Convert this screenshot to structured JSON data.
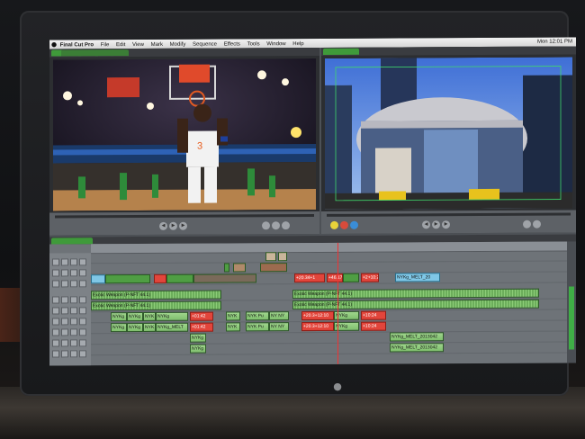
{
  "menubar": {
    "app_name": "Final Cut Pro",
    "menus": [
      "File",
      "Edit",
      "View",
      "Mark",
      "Modify",
      "Sequence",
      "Effects",
      "Tools",
      "Window",
      "Help"
    ],
    "clock": "Mon 12:01 PM"
  },
  "timeline": {
    "clips": {
      "v_nyk_melt": "NYKg_MELT_20",
      "red1": "+20.34+1",
      "red2": "+46.17",
      "red3": "+2+10:25",
      "a1_title": "Exotic Weapon (P-NFT 44.1)",
      "a1_title2": "Exotic Weapon (P-NFT 44.1)",
      "a2_title": "Exotic Weapon (P-NFT 44.1)",
      "a2_title2": "Exotic Weapon (P-NFT 44.1)",
      "a3_1": "NYKg",
      "a3_2": "NYKg",
      "a3_3": "NYK",
      "a3_4": "NYKg",
      "a3_red1": "+01:42",
      "a3_5": "NYK",
      "a3_6": "NYK Pu",
      "a3_7": "NY NY",
      "a3_red2": "+20.3+12:10",
      "a3_8": "NYKg",
      "a3_red3": "+10:24",
      "a4_1": "NYKg",
      "a4_2": "NYKg",
      "a4_3": "NYK",
      "a4_4": "NYKg_MELT",
      "a4_red1": "+01:42",
      "a4_5": "NYK",
      "a4_6": "NYK Pu",
      "a4_7": "NY NY",
      "a4_red2": "+20.3+12:10",
      "a4_8": "NYKg",
      "a4_red3": "+10:24",
      "a5_1": "NYKg",
      "a5_2": "NYKg_MELT_2013042",
      "a6_1": "NYKg",
      "a6_2": "NYKg_MELT_2013042"
    }
  },
  "colors": {
    "green_clip": "#7fbf6d",
    "blue_clip": "#7fc7e6",
    "red_clip": "#e2453b",
    "tab_green": "#3f9a3a"
  }
}
